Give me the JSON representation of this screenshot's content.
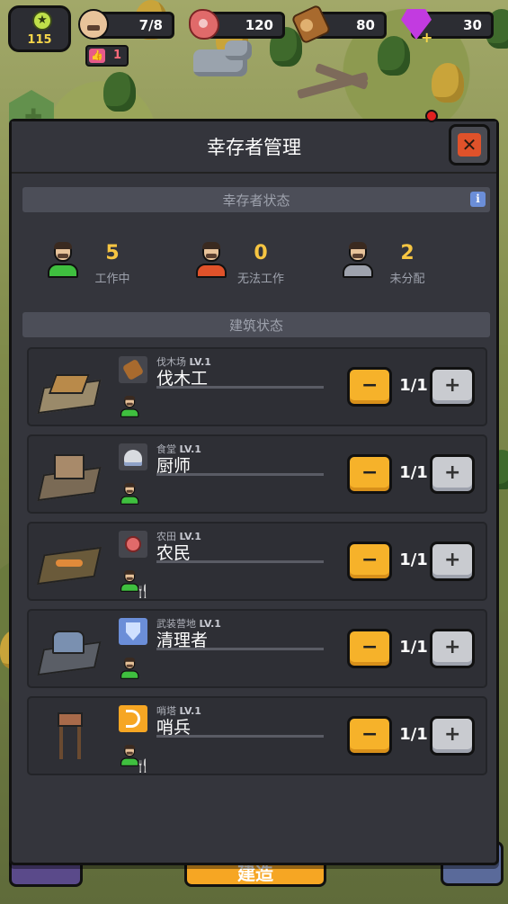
{
  "hud": {
    "level": "115",
    "survivors": "7/8",
    "meat": "120",
    "wood": "80",
    "gems": "30",
    "likes": "1"
  },
  "modal": {
    "title": "幸存者管理",
    "close_label": "✕",
    "status_section": "幸存者状态",
    "info_label": "i",
    "stats": [
      {
        "count": "5",
        "label": "工作中",
        "color": "#3fbf3f"
      },
      {
        "count": "0",
        "label": "无法工作",
        "color": "#e0522a"
      },
      {
        "count": "2",
        "label": "未分配",
        "color": "#9ea2ad"
      }
    ],
    "building_section": "建筑状态",
    "buildings": [
      {
        "building": "伐木场",
        "level": "LV.1",
        "job": "伐木工",
        "count": "1/1",
        "icon": "log-icon",
        "minus": "−",
        "plus": "+"
      },
      {
        "building": "食堂",
        "level": "LV.1",
        "job": "厨师",
        "count": "1/1",
        "icon": "cloche-icon",
        "minus": "−",
        "plus": "+"
      },
      {
        "building": "农田",
        "level": "LV.1",
        "job": "农民",
        "count": "1/1",
        "icon": "meat-icon",
        "minus": "−",
        "plus": "+"
      },
      {
        "building": "武装营地",
        "level": "LV.1",
        "job": "清理者",
        "count": "1/1",
        "icon": "shield-icon",
        "minus": "−",
        "plus": "+"
      },
      {
        "building": "哨塔",
        "level": "LV.1",
        "job": "哨兵",
        "count": "1/1",
        "icon": "bow-icon",
        "minus": "−",
        "plus": "+"
      }
    ]
  },
  "bottom": {
    "build_label": "建造"
  }
}
